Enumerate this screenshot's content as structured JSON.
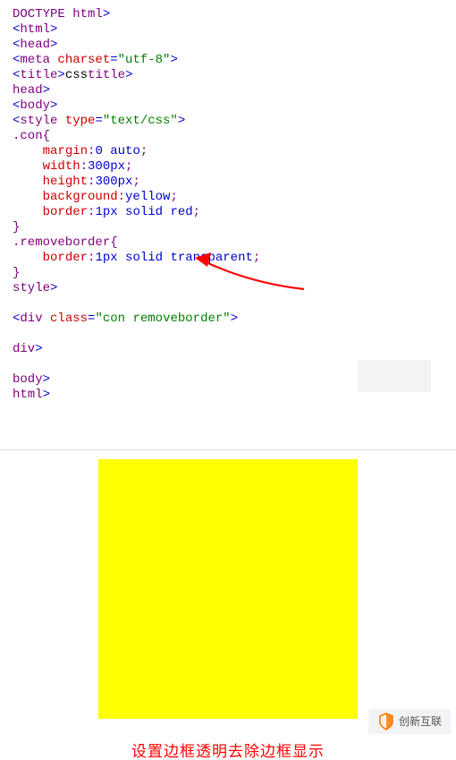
{
  "code": {
    "lines": [
      {
        "t": "tag",
        "open": "<!",
        "name": "DOCTYPE html",
        "close": ">"
      },
      {
        "t": "tag",
        "open": "<",
        "name": "html",
        "close": ">"
      },
      {
        "t": "tag",
        "open": "<",
        "name": "head",
        "close": ">"
      },
      {
        "t": "tag_attr",
        "open": "<",
        "name": "meta",
        "sp": " ",
        "attrname": "charset",
        "eq": "=",
        "attrval": "\"utf-8\"",
        "close": ">"
      },
      {
        "t": "tagpair",
        "open": "<",
        "name": "title",
        "close": ">",
        "text": "css",
        "open2": "</",
        "name2": "title",
        "close2": ">"
      },
      {
        "t": "tag",
        "open": "</",
        "name": "head",
        "close": ">"
      },
      {
        "t": "tag",
        "open": "<",
        "name": "body",
        "close": ">"
      },
      {
        "t": "tag_attr",
        "open": "<",
        "name": "style",
        "sp": " ",
        "attrname": "type",
        "eq": "=",
        "attrval": "\"text/css\"",
        "close": ">"
      },
      {
        "t": "sel",
        "text": ".con",
        "brace": "{"
      },
      {
        "t": "decl",
        "indent": "    ",
        "prop": "margin",
        "colon": ":",
        "val": "0 auto",
        "semi": ";"
      },
      {
        "t": "decl",
        "indent": "    ",
        "prop": "width",
        "colon": ":",
        "val": "300px",
        "semi": ";"
      },
      {
        "t": "decl",
        "indent": "    ",
        "prop": "height",
        "colon": ":",
        "val": "300px",
        "semi": ";"
      },
      {
        "t": "decl",
        "indent": "    ",
        "prop": "background",
        "colon": ":",
        "val": "yellow",
        "semi": ";"
      },
      {
        "t": "decl",
        "indent": "    ",
        "prop": "border",
        "colon": ":",
        "val": "1px solid red",
        "semi": ";"
      },
      {
        "t": "brace",
        "text": "}"
      },
      {
        "t": "sel",
        "text": ".removeborder",
        "brace": "{"
      },
      {
        "t": "decl",
        "indent": "    ",
        "prop": "border",
        "colon": ":",
        "val": "1px solid transparent",
        "semi": ";"
      },
      {
        "t": "brace",
        "text": "}"
      },
      {
        "t": "tag",
        "open": "</",
        "name": "style",
        "close": ">"
      },
      {
        "t": "blank"
      },
      {
        "t": "tag_attr",
        "open": "<",
        "name": "div",
        "sp": " ",
        "attrname": "class",
        "eq": "=",
        "attrval": "\"con removeborder\"",
        "close": ">"
      },
      {
        "t": "blank"
      },
      {
        "t": "tag",
        "open": "</",
        "name": "div",
        "close": ">"
      },
      {
        "t": "blank"
      },
      {
        "t": "tag",
        "open": "</",
        "name": "body",
        "close": ">"
      },
      {
        "t": "tag",
        "open": "</",
        "name": "html",
        "close": ">"
      }
    ]
  },
  "caption": "设置边框透明去除边框显示",
  "watermark": "创新互联",
  "arrow_color": "#ff0000",
  "demo_bg": "#ffff00"
}
